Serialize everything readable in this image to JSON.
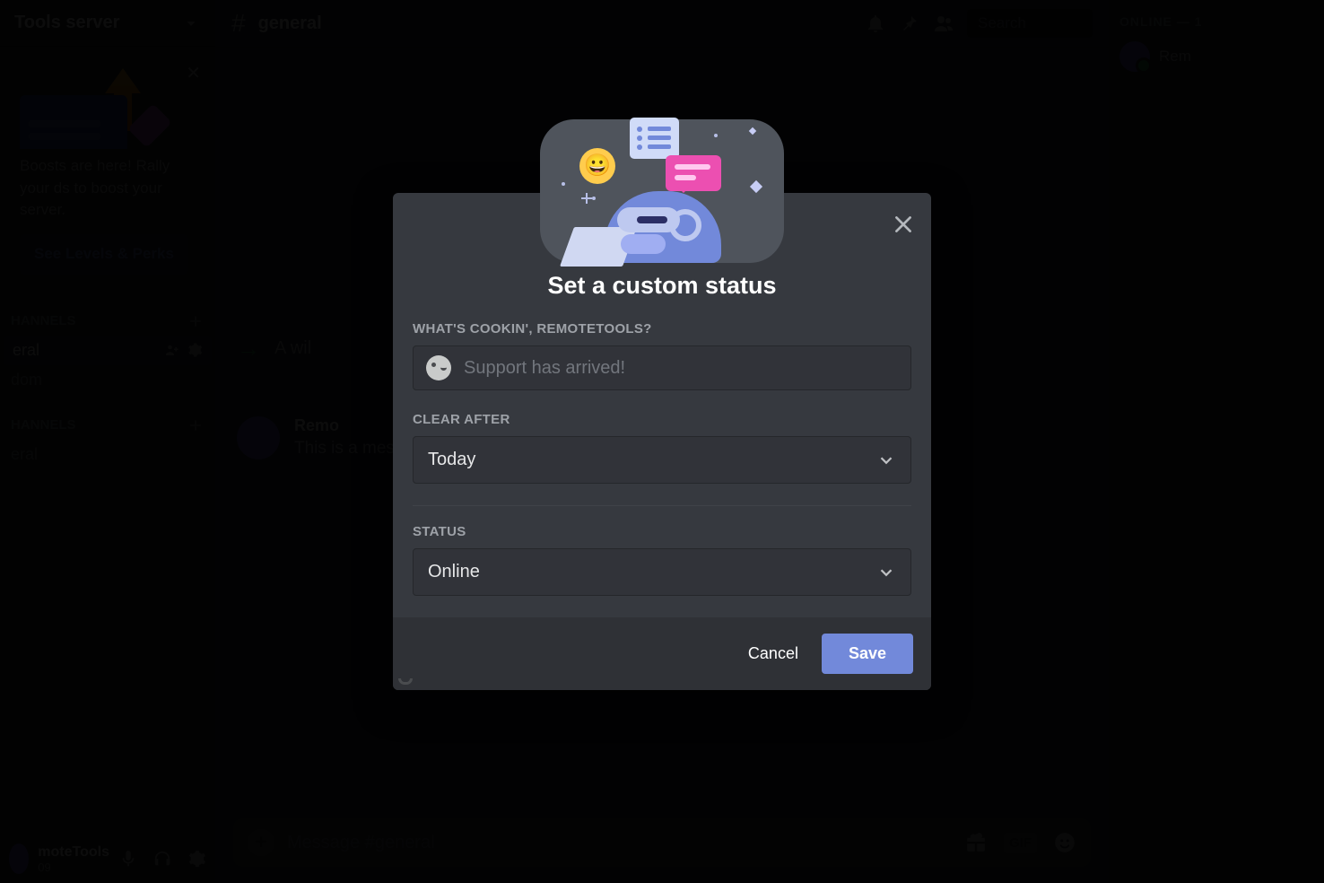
{
  "server": {
    "name": "Tools server",
    "boost_banner_text": "Boosts are here! Rally your ds to boost your server.",
    "perks_button": "See Levels & Perks"
  },
  "channels": {
    "text_label": "HANNELS",
    "voice_label": "HANNELS",
    "text": [
      {
        "name": "eral",
        "selected": true
      },
      {
        "name": "dom",
        "selected": false
      }
    ],
    "voice": [
      {
        "name": "eral",
        "selected": false
      }
    ]
  },
  "user_panel": {
    "name": "moteTools",
    "tag": "09"
  },
  "topbar": {
    "channel_name": "general",
    "search_placeholder": "Search"
  },
  "messages": {
    "system_text": "A wil",
    "msg_user": "Remo",
    "msg_body": "This is a message."
  },
  "composer": {
    "placeholder": "Message #general",
    "gif_label": "GIF"
  },
  "members": {
    "section_label": "ONLINE — 1",
    "list": [
      {
        "name": "Rem"
      }
    ]
  },
  "modal": {
    "title": "Set a custom status",
    "field_status_label": "WHAT'S COOKIN', REMOTETOOLS?",
    "status_placeholder": "Support has arrived!",
    "field_clear_label": "CLEAR AFTER",
    "clear_value": "Today",
    "field_presence_label": "STATUS",
    "presence_value": "Online",
    "cancel": "Cancel",
    "save": "Save"
  }
}
